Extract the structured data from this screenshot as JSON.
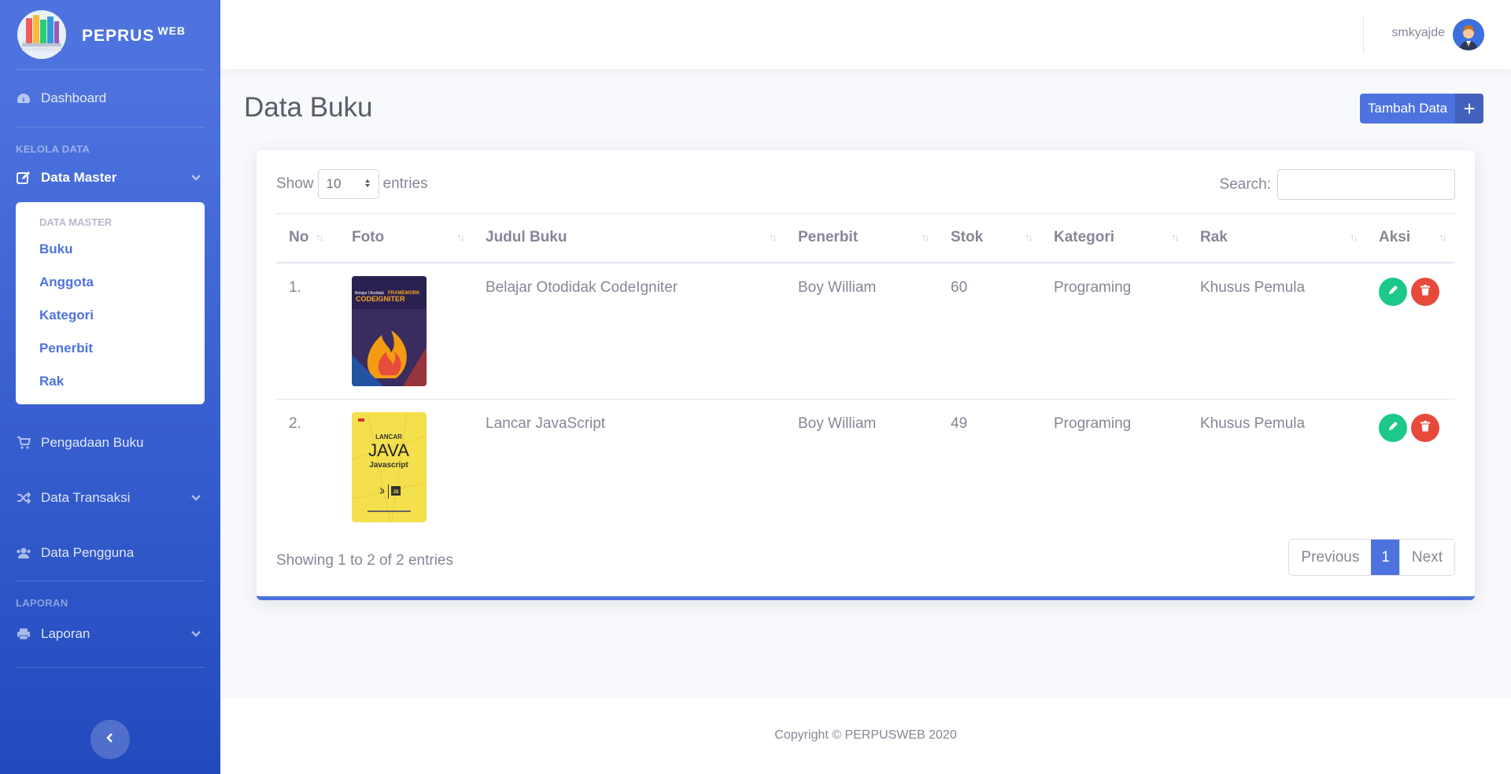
{
  "brand": {
    "name": "PEPRUS",
    "sup": "WEB"
  },
  "sidebar": {
    "dashboard": "Dashboard",
    "heading_kelola": "KELOLA DATA",
    "data_master": "Data Master",
    "submenu_header": "DATA MASTER",
    "submenu": [
      "Buku",
      "Anggota",
      "Kategori",
      "Penerbit",
      "Rak"
    ],
    "pengadaan": "Pengadaan Buku",
    "transaksi": "Data Transaksi",
    "pengguna": "Data Pengguna",
    "heading_laporan": "LAPORAN",
    "laporan": "Laporan"
  },
  "topbar": {
    "username": "smkyajde"
  },
  "page": {
    "title": "Data Buku",
    "add_button": "Tambah Data",
    "add_icon": "+"
  },
  "table_controls": {
    "show": "Show",
    "entries_value": "10",
    "entries": "entries",
    "search_label": "Search:"
  },
  "table": {
    "headers": [
      "No",
      "Foto",
      "Judul Buku",
      "Penerbit",
      "Stok",
      "Kategori",
      "Rak",
      "Aksi"
    ],
    "rows": [
      {
        "no": "1.",
        "cover": "codeigniter-cover",
        "judul": "Belajar Otodidak CodeIgniter",
        "penerbit": "Boy William",
        "stok": "60",
        "kategori": "Programing",
        "rak": "Khusus Pemula"
      },
      {
        "no": "2.",
        "cover": "javascript-cover",
        "judul": "Lancar JavaScript",
        "penerbit": "Boy William",
        "stok": "49",
        "kategori": "Programing",
        "rak": "Khusus Pemula"
      }
    ]
  },
  "covers": {
    "book1": {
      "top": "Belajar Otodidak",
      "framework": "FRAMEWORK",
      "name": "CODEIGNITER"
    },
    "book2": {
      "lancar": "LANCAR",
      "java": "JAVA",
      "javascript": "Javascript",
      "js": "JS"
    }
  },
  "pagination": {
    "info": "Showing 1 to 2 of 2 entries",
    "previous": "Previous",
    "current": "1",
    "next": "Next"
  },
  "footer": {
    "copyright": "Copyright © PERPUSWEB 2020"
  },
  "colors": {
    "primary": "#4e73df",
    "success": "#1cc88a",
    "danger": "#e74a3b"
  },
  "icons": [
    "tachometer-icon",
    "edit-icon",
    "chevron-down-icon",
    "cart-icon",
    "shuffle-icon",
    "users-icon",
    "printer-icon",
    "chevron-left-icon",
    "pencil-icon",
    "trash-icon",
    "plus-icon"
  ]
}
